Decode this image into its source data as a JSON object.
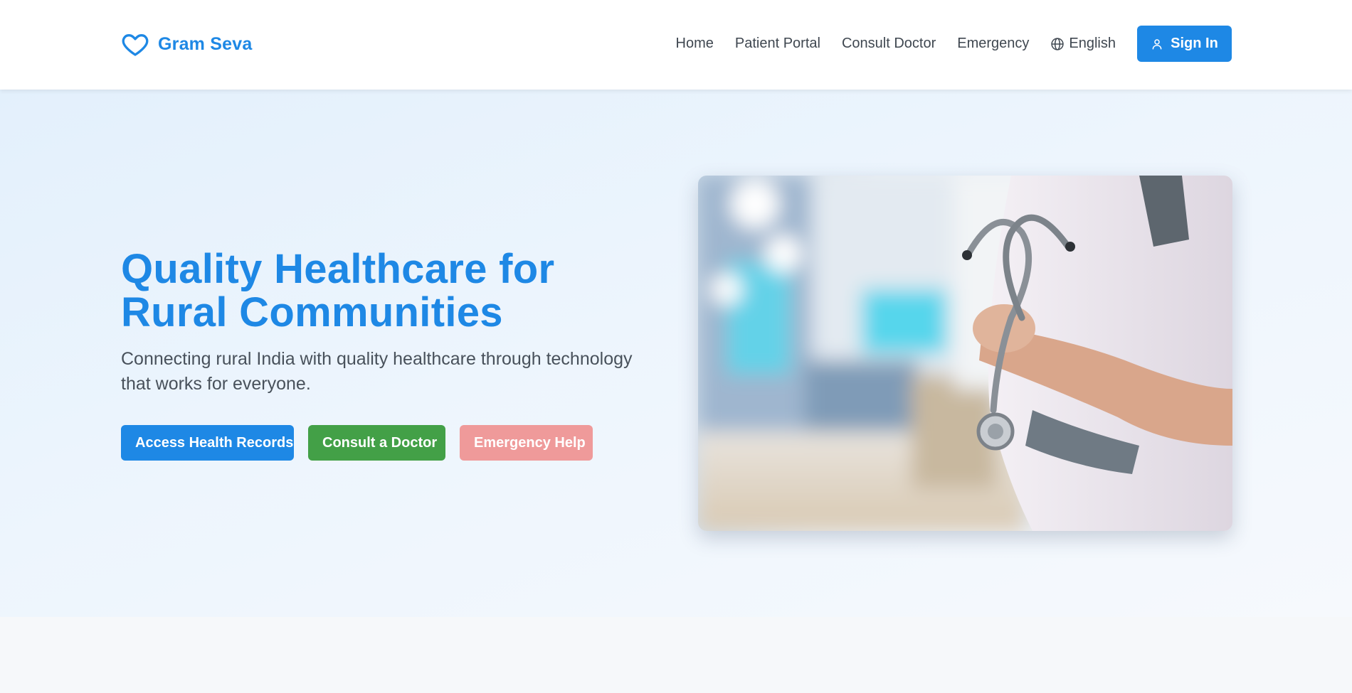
{
  "brand": {
    "name": "Gram Seva",
    "icon": "heart-icon",
    "color": "#1e88e5"
  },
  "nav": {
    "links": [
      "Home",
      "Patient Portal",
      "Consult Doctor",
      "Emergency"
    ],
    "language": {
      "icon": "globe-icon",
      "label": "English"
    },
    "signin": {
      "icon": "user-icon",
      "label": "Sign In"
    }
  },
  "hero": {
    "title": "Quality Healthcare for Rural Communities",
    "subtitle": "Connecting rural India with quality healthcare through technology that works for everyone.",
    "buttons": [
      {
        "label": "Access Health Records",
        "color": "#1e88e5"
      },
      {
        "label": "Consult a Doctor",
        "color": "#43a047"
      },
      {
        "label": "Emergency Help",
        "color": "#ef9a9a"
      }
    ],
    "image_alt": "Doctor with stethoscope, arms crossed, hospital corridor background"
  }
}
